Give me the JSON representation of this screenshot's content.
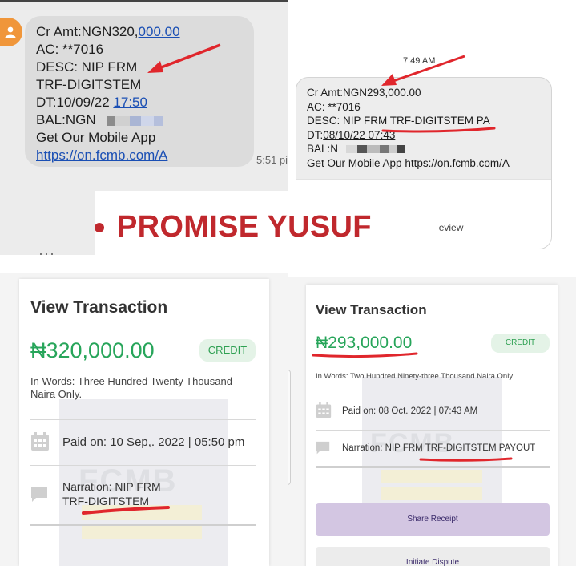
{
  "sms1": {
    "line1_prefix": "Cr Amt:NGN320,",
    "line1_link": "000.00",
    "line2": "AC: **7016",
    "line3": "DESC: NIP FRM",
    "line4": "TRF-DIGITSTEM",
    "line5_prefix": "DT:10/09/22 ",
    "line5_link": "17:50",
    "line6_prefix": "BAL:NGN",
    "line7": "Get Our Mobile App",
    "line8_link": "https://on.fcmb.com/A",
    "time": "5:51 pi"
  },
  "sms2": {
    "time": "7:49 AM",
    "line1": "Cr Amt:NGN293,000.00",
    "line2": "AC: **7016",
    "line3": "DESC: NIP FRM TRF-DIGITSTEM PA",
    "line4_prefix": "DT:",
    "line4_link": "08/10/22 07:43",
    "line5_prefix": "BAL:N",
    "line6_prefix": "Get Our Mobile App ",
    "line6_link": "https://on.fcmb.com/A",
    "preview_text": "Tap to load preview"
  },
  "banner": {
    "name": "PROMISE YUSUF"
  },
  "view1": {
    "title": "View Transaction",
    "amount": "₦320,000.00",
    "badge": "CREDIT",
    "in_words": "In Words: Three Hundred Twenty Thousand Naira  Only.",
    "paid_on": "Paid on: 10 Sep,. 2022 | 05:50 pm",
    "narration_line1": "Narration: NIP FRM",
    "narration_line2": "TRF-DIGITSTEM"
  },
  "view2": {
    "title": "View Transaction",
    "amount": "₦293,000.00",
    "badge": "CREDIT",
    "in_words": "In Words: Two Hundred Ninety-three Thousand Naira  Only.",
    "paid_on": "Paid on: 08 Oct. 2022 | 07:43 AM",
    "narration": "Narration: NIP FRM TRF-DIGITSTEM PAYOUT",
    "share_label": "Share Receipt",
    "dispute_label": "Initiate Dispute"
  },
  "watermark_text": "FCMB",
  "colors": {
    "amount_green": "#27a55a",
    "annotation_red": "#e0262c",
    "banner_red": "#c0282d",
    "link_blue": "#1a4fb4",
    "button_lilac": "#d3c6e2"
  }
}
